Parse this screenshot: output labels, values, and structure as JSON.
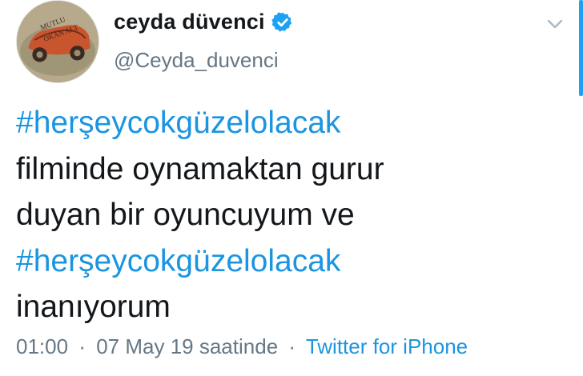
{
  "user": {
    "display_name": "ceyda düvenci",
    "handle": "@Ceyda_duvenci",
    "verified": true,
    "avatar_text": "MUTLU OKAN ALT"
  },
  "tweet": {
    "lines": [
      {
        "text": "#herşeycokgüzelolacak",
        "hashtag": true
      },
      {
        "text": "filminde oynamaktan gurur",
        "hashtag": false
      },
      {
        "text": "duyan bir oyuncuyum ve",
        "hashtag": false
      },
      {
        "text": "#herşeycokgüzelolacak",
        "hashtag": true
      },
      {
        "text": "inanıyorum",
        "hashtag": false
      }
    ]
  },
  "meta": {
    "time": "01:00",
    "date": "07 May 19 saatinde",
    "source": "Twitter for iPhone",
    "separator": "·"
  },
  "icons": {
    "verified": "verified-badge-icon",
    "caret": "chevron-down-icon"
  },
  "colors": {
    "link": "#1b95e0",
    "text": "#14171a",
    "secondary": "#657786",
    "accent": "#1da1f2"
  }
}
